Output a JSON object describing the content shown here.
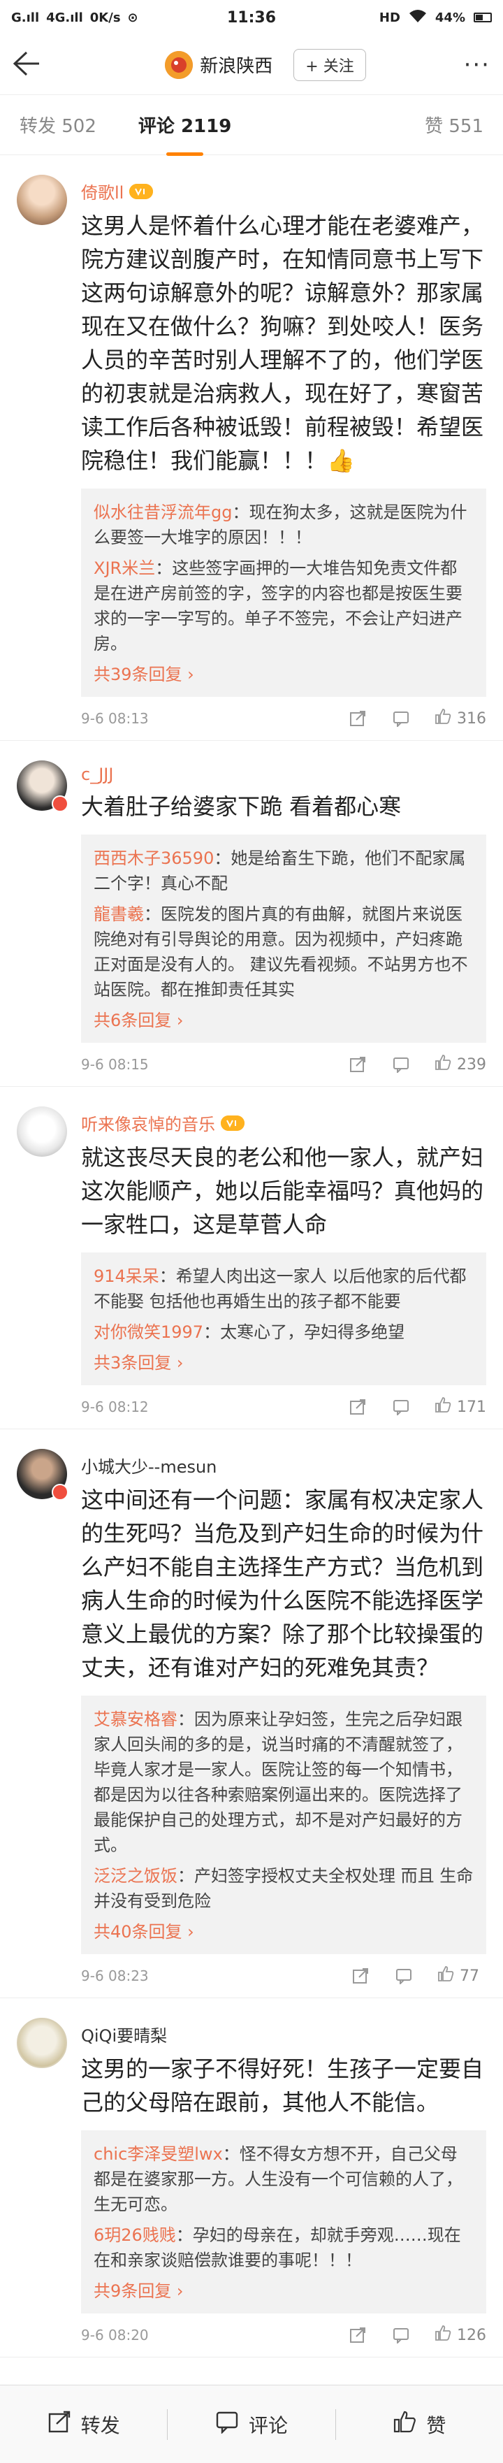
{
  "statusbar": {
    "left": [
      "G.ıll",
      "4G.ıll",
      "0K/s",
      "⊙"
    ],
    "time": "11:36",
    "right": [
      "HD",
      "44%"
    ]
  },
  "navbar": {
    "account_name": "新浪陕西",
    "follow_label": "+ 关注",
    "more_label": "···"
  },
  "tabs": {
    "repost": "转发 502",
    "comments": "评论 2119",
    "likes": "赞 551"
  },
  "comments": [
    {
      "user": "倚歌ll",
      "vip": true,
      "text": "这男人是怀着什么心理才能在老婆难产，院方建议剖腹产时，在知情同意书上写下这两句谅解意外的呢？谅解意外？那家属现在又在做什么？狗嘛？到处咬人！医务人员的辛苦时别人理解不了的，他们学医的初衷就是治病救人，现在好了，寒窗苦读工作后各种被诋毁！前程被毁！希望医院稳住！我们能赢！！！👍",
      "replies": [
        {
          "name": "似水往昔浮流年gg",
          "text": "：现在狗太多，这就是医院为什么要签一大堆字的原因！！！"
        },
        {
          "name": "XJR米兰",
          "text": "：这些签字画押的一大堆告知免责文件都是在进产房前签的字，签字的内容也都是按医生要求的一字一字写的。单子不签完，不会让产妇进产房。"
        }
      ],
      "more": "共39条回复 ›",
      "time": "9-6 08:13",
      "likes": "316"
    },
    {
      "user": "c_JJJ",
      "vip": false,
      "text": "大着肚子给婆家下跪 看着都心寒",
      "replies": [
        {
          "name": "西西木子36590",
          "text": "：她是给畜生下跪，他们不配家属二个字！真心不配"
        },
        {
          "name": "龍書羲",
          "text": "：医院发的图片真的有曲解，就图片来说医院绝对有引导舆论的用意。因为视频中，产妇疼跪正对面是没有人的。 建议先看视频。不站男方也不站医院。都在推卸责任其实"
        }
      ],
      "more": "共6条回复 ›",
      "time": "9-6 08:15",
      "likes": "239"
    },
    {
      "user": "听来像哀悼的音乐",
      "vip": true,
      "text": "就这丧尽天良的老公和他一家人，就产妇这次能顺产，她以后能幸福吗？真他妈的一家牲口，这是草菅人命",
      "replies": [
        {
          "name": "914呆呆",
          "text": "：希望人肉出这一家人 以后他家的后代都不能娶 包括他也再婚生出的孩子都不能要"
        },
        {
          "name": "对你微笑1997",
          "text": "：太寒心了，孕妇得多绝望"
        }
      ],
      "more": "共3条回复 ›",
      "time": "9-6 08:12",
      "likes": "171"
    },
    {
      "user": "小城大少--mesun",
      "vip": false,
      "text": "这中间还有一个问题：家属有权决定家人的生死吗？当危及到产妇生命的时候为什么产妇不能自主选择生产方式？当危机到病人生命的时候为什么医院不能选择医学意义上最优的方案？除了那个比较操蛋的丈夫，还有谁对产妇的死难免其责？",
      "replies": [
        {
          "name": "艾慕安格睿",
          "text": "：因为原来让孕妇签，生完之后孕妇跟家人回头闹的多的是，说当时痛的不清醒就签了，毕竟人家才是一家人。医院让签的每一个知情书，都是因为以往各种索赔案例逼出来的。医院选择了最能保护自己的处理方式，却不是对产妇最好的方式。"
        },
        {
          "name": "泛泛之饭饭",
          "text": "：产妇签字授权丈夫全权处理 而且 生命并没有受到危险"
        }
      ],
      "more": "共40条回复 ›",
      "time": "9-6 08:23",
      "likes": "77"
    },
    {
      "user": "QiQi要晴梨",
      "vip": false,
      "text": "这男的一家子不得好死！生孩子一定要自己的父母陪在跟前，其他人不能信。",
      "replies": [
        {
          "name": "chic李泽旻塑lwx",
          "text": "：怪不得女方想不开，自己父母都是在婆家那一方。人生没有一个可信赖的人了，生无可恋。"
        },
        {
          "name": "6玥26贱贱",
          "text": "：孕妇的母亲在，却就手旁观……现在在和亲家谈赔偿款谁要的事呢！！！"
        }
      ],
      "more": "共9条回复 ›",
      "time": "9-6 08:20",
      "likes": "126"
    }
  ],
  "bottombar": {
    "repost": "转发",
    "comment": "评论",
    "like": "赞"
  },
  "colors": {
    "accent": "#eb7350",
    "tab_underline": "#ff8200",
    "reply_bg": "#f2f2f2"
  }
}
